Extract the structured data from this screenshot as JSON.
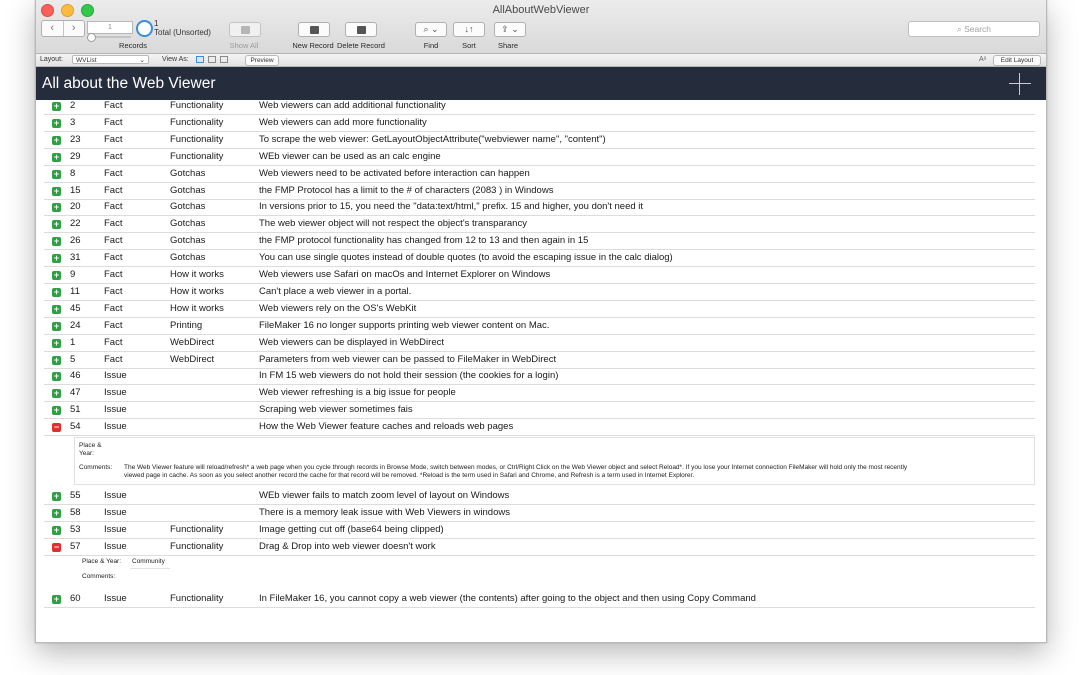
{
  "window": {
    "title": "AllAboutWebViewer"
  },
  "toolbar": {
    "record_field": "1",
    "count_number": "1",
    "count_status": "Total (Unsorted)",
    "records_label": "Records",
    "show_all_label": "Show All",
    "new_record_label": "New Record",
    "delete_record_label": "Delete Record",
    "find_label": "Find",
    "sort_label": "Sort",
    "share_label": "Share",
    "search_placeholder": "Search"
  },
  "layout_bar": {
    "layout_label": "Layout:",
    "layout_value": "WVList",
    "view_as_label": "View As:",
    "preview_label": "Preview",
    "edit_layout_label": "Edit Layout"
  },
  "header": {
    "title": "All about the Web Viewer"
  },
  "rows_a": [
    {
      "status": "plus",
      "num": "2",
      "type": "Fact",
      "cat": "Functionality",
      "desc": "Web viewers can add additional functionality"
    },
    {
      "status": "plus",
      "num": "3",
      "type": "Fact",
      "cat": "Functionality",
      "desc": "Web viewers can add more functionality"
    },
    {
      "status": "plus",
      "num": "23",
      "type": "Fact",
      "cat": "Functionality",
      "desc": "To scrape the web viewer: GetLayoutObjectAttribute(\"webviewer name\", \"content\")"
    },
    {
      "status": "plus",
      "num": "29",
      "type": "Fact",
      "cat": "Functionality",
      "desc": "WEb viewer can be used as an calc engine"
    },
    {
      "status": "plus",
      "num": "8",
      "type": "Fact",
      "cat": "Gotchas",
      "desc": "Web viewers need to be activated before interaction can happen"
    },
    {
      "status": "plus",
      "num": "15",
      "type": "Fact",
      "cat": "Gotchas",
      "desc": "the FMP Protocol has a limit to the # of characters (2083 ) in Windows"
    },
    {
      "status": "plus",
      "num": "20",
      "type": "Fact",
      "cat": "Gotchas",
      "desc": "In versions prior to 15, you need the \"data:text/html,\" prefix. 15 and higher, you don't need it"
    },
    {
      "status": "plus",
      "num": "22",
      "type": "Fact",
      "cat": "Gotchas",
      "desc": "The web viewer object will not respect the object's transparancy"
    },
    {
      "status": "plus",
      "num": "26",
      "type": "Fact",
      "cat": "Gotchas",
      "desc": "the FMP protocol functionality has changed from 12 to 13 and then again in 15"
    },
    {
      "status": "plus",
      "num": "31",
      "type": "Fact",
      "cat": "Gotchas",
      "desc": "You can use single quotes instead of double quotes (to avoid the escaping issue in the calc dialog)"
    },
    {
      "status": "plus",
      "num": "9",
      "type": "Fact",
      "cat": "How it works",
      "desc": "Web viewers use Safari on macOs and Internet Explorer on Windows"
    },
    {
      "status": "plus",
      "num": "11",
      "type": "Fact",
      "cat": "How it works",
      "desc": "Can't place a web viewer in a portal."
    },
    {
      "status": "plus",
      "num": "45",
      "type": "Fact",
      "cat": "How it works",
      "desc": "Web viewers rely on the OS's WebKit"
    },
    {
      "status": "plus",
      "num": "24",
      "type": "Fact",
      "cat": "Printing",
      "desc": "FileMaker 16 no longer supports printing web viewer content on Mac."
    },
    {
      "status": "plus",
      "num": "1",
      "type": "Fact",
      "cat": "WebDirect",
      "desc": "Web viewers can be displayed in WebDirect"
    },
    {
      "status": "plus",
      "num": "5",
      "type": "Fact",
      "cat": "WebDirect",
      "desc": "Parameters from web viewer can be passed to FileMaker in WebDirect"
    },
    {
      "status": "plus",
      "num": "46",
      "type": "Issue",
      "cat": "",
      "desc": "In FM 15 web viewers do not hold their session (the cookies for a login)"
    },
    {
      "status": "plus",
      "num": "47",
      "type": "Issue",
      "cat": "",
      "desc": "Web viewer refreshing is a big issue for people"
    },
    {
      "status": "plus",
      "num": "51",
      "type": "Issue",
      "cat": "",
      "desc": "Scraping web viewer sometimes fais"
    },
    {
      "status": "minus",
      "num": "54",
      "type": "Issue",
      "cat": "",
      "desc": "How the Web Viewer feature caches and reloads web pages"
    }
  ],
  "detail_54": {
    "place_label": "Place & Year:",
    "place_value": "",
    "comments_label": "Comments:",
    "comments_line1": "The Web Viewer feature will reload/refresh* a web page when you cycle through records in Browse Mode, switch between modes, or Ctrl/Right Click on the Web Viewer object and select Reload*. If you lose your Internet connection FileMaker will hold only the most recently",
    "comments_line2": "viewed page in cache. As soon as you select another record the cache for that record will be removed. *Reload is the term used in Safari and Chrome, and Refresh is a term used in Internet Explorer."
  },
  "rows_b": [
    {
      "status": "plus",
      "num": "55",
      "type": "Issue",
      "cat": "",
      "desc": "WEb viewer fails to match zoom level of layout on Windows"
    },
    {
      "status": "plus",
      "num": "58",
      "type": "Issue",
      "cat": "",
      "desc": "There is a memory leak issue with Web Viewers in windows"
    },
    {
      "status": "plus",
      "num": "53",
      "type": "Issue",
      "cat": "Functionality",
      "desc": "Image getting cut off (base64 being clipped)"
    },
    {
      "status": "minus",
      "num": "57",
      "type": "Issue",
      "cat": "Functionality",
      "desc": "Drag & Drop into web viewer doesn't work"
    }
  ],
  "detail_57": {
    "place_label": "Place & Year:",
    "place_value": "Community",
    "comments_label": "Comments:",
    "comments_value": ""
  },
  "rows_c": [
    {
      "status": "plus",
      "num": "60",
      "type": "Issue",
      "cat": "Functionality",
      "desc": "In FileMaker 16, you cannot copy a web viewer (the contents) after going to the object and then using Copy Command"
    }
  ],
  "icons": {
    "plus_color": "#2ea043",
    "minus_color": "#e02f2f",
    "header_bg": "#252d3d"
  }
}
